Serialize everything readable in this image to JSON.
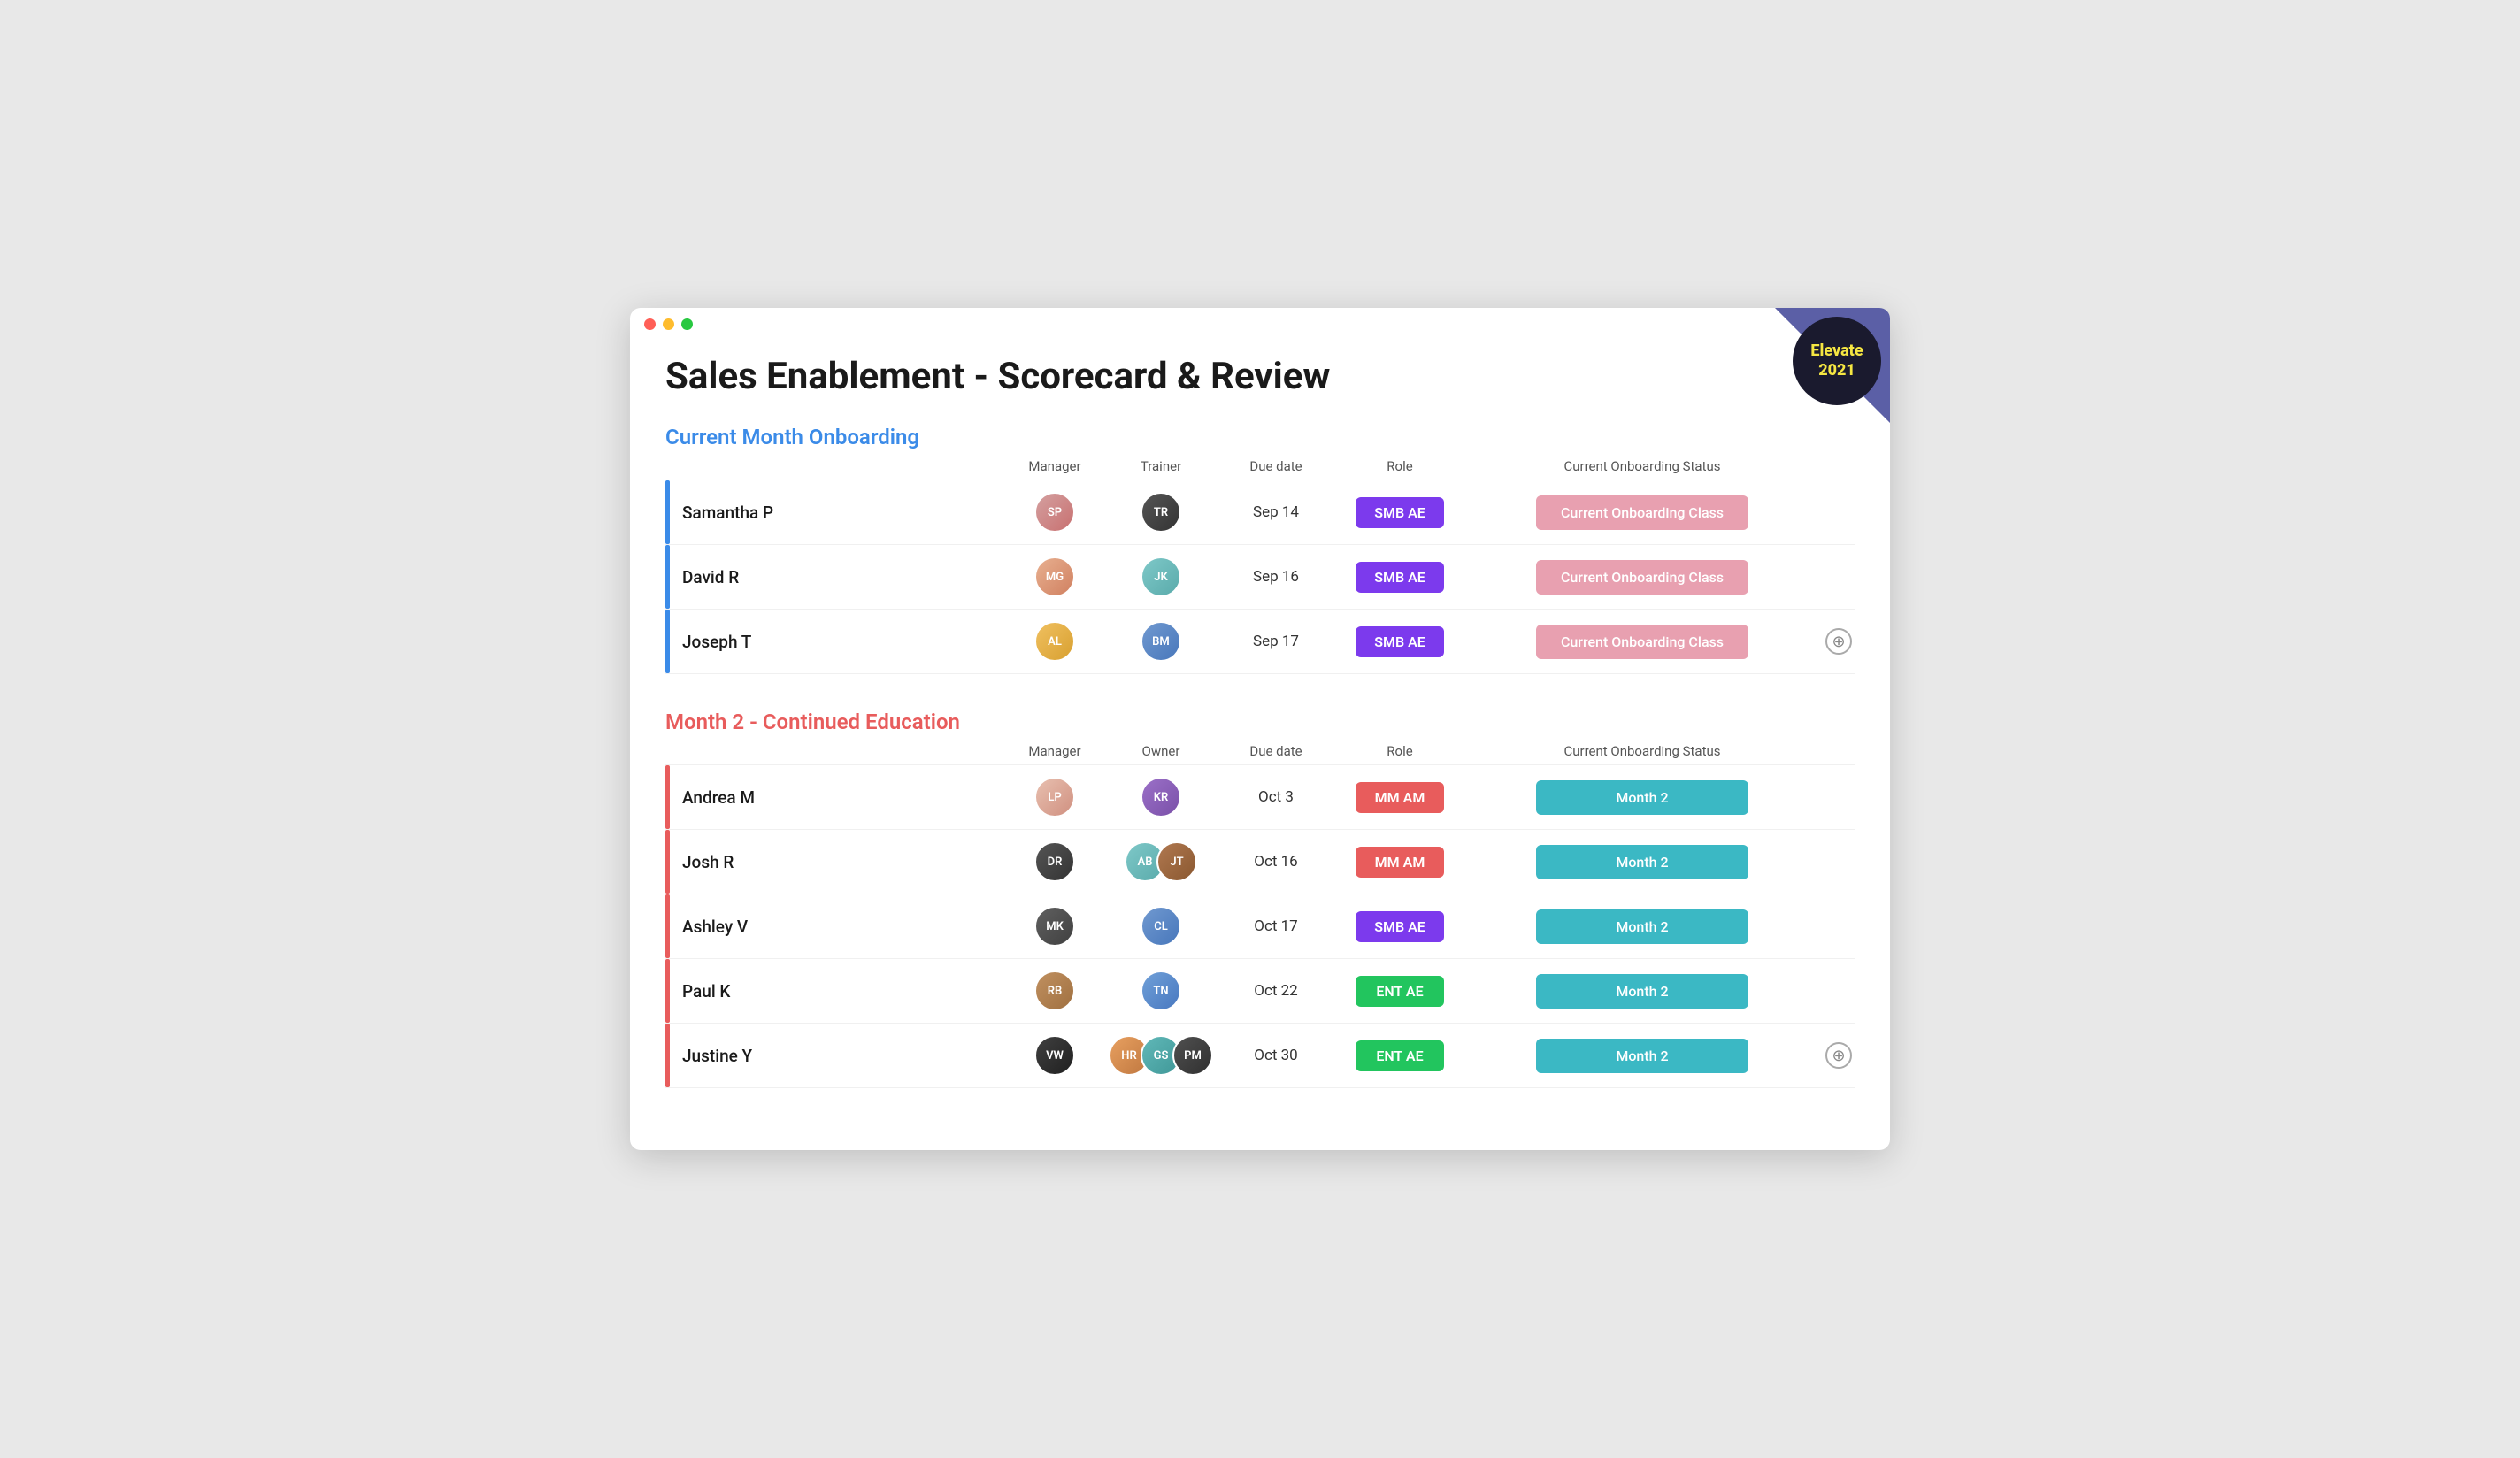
{
  "window": {
    "title": "Sales Enablement - Scorecard & Review"
  },
  "header": {
    "title": "Sales Enablement - Scorecard & Review"
  },
  "elevate": {
    "line1": "Elevate",
    "line2": "2021"
  },
  "section1": {
    "title": "Current Month Onboarding",
    "col_name": "",
    "col_manager": "Manager",
    "col_trainer": "Trainer",
    "col_due": "Due date",
    "col_role": "Role",
    "col_status": "Current Onboarding Status",
    "rows": [
      {
        "name": "Samantha P",
        "due": "Sep 14",
        "role": "SMB AE",
        "role_color": "purple",
        "status": "Current Onboarding Class",
        "status_color": "pink",
        "manager_initials": "SP",
        "manager_color": "pink",
        "trainer_initials": "TR",
        "trainer_color": "dark"
      },
      {
        "name": "David R",
        "due": "Sep 16",
        "role": "SMB AE",
        "role_color": "purple",
        "status": "Current Onboarding Class",
        "status_color": "pink",
        "manager_initials": "MG",
        "manager_color": "orange",
        "trainer_initials": "JK",
        "trainer_color": "teal"
      },
      {
        "name": "Joseph T",
        "due": "Sep 17",
        "role": "SMB AE",
        "role_color": "purple",
        "status": "Current Onboarding Class",
        "status_color": "pink",
        "manager_initials": "AL",
        "manager_color": "orange",
        "trainer_initials": "BM",
        "trainer_color": "blue"
      }
    ]
  },
  "section2": {
    "title": "Month 2 - Continued Education",
    "col_name": "",
    "col_manager": "Manager",
    "col_owner": "Owner",
    "col_due": "Due date",
    "col_role": "Role",
    "col_status": "Current Onboarding Status",
    "rows": [
      {
        "name": "Andrea M",
        "due": "Oct 3",
        "role": "MM AM",
        "role_color": "red",
        "status": "Month 2",
        "status_color": "teal",
        "manager_initials": "LP",
        "manager_color": "pink",
        "owner_initials": [
          "KR"
        ],
        "owner_colors": [
          "purple"
        ]
      },
      {
        "name": "Josh R",
        "due": "Oct 16",
        "role": "MM AM",
        "role_color": "red",
        "status": "Month 2",
        "status_color": "teal",
        "manager_initials": "DR",
        "manager_color": "dark",
        "owner_initials": [
          "AB",
          "JT"
        ],
        "owner_colors": [
          "teal",
          "brown"
        ]
      },
      {
        "name": "Ashley V",
        "due": "Oct 17",
        "role": "SMB AE",
        "role_color": "purple",
        "status": "Month 2",
        "status_color": "teal",
        "manager_initials": "MK",
        "manager_color": "dark",
        "owner_initials": [
          "CL"
        ],
        "owner_colors": [
          "blue"
        ]
      },
      {
        "name": "Paul K",
        "due": "Oct 22",
        "role": "ENT AE",
        "role_color": "green",
        "status": "Month 2",
        "status_color": "teal",
        "manager_initials": "RB",
        "manager_color": "brown",
        "owner_initials": [
          "TN"
        ],
        "owner_colors": [
          "blue"
        ]
      },
      {
        "name": "Justine Y",
        "due": "Oct 30",
        "role": "ENT AE",
        "role_color": "green",
        "status": "Month 2",
        "status_color": "teal",
        "manager_initials": "VW",
        "manager_color": "dark",
        "owner_initials": [
          "HR",
          "GS",
          "PM"
        ],
        "owner_colors": [
          "orange",
          "teal",
          "dark"
        ]
      }
    ]
  },
  "colors": {
    "purple": "#7c3aed",
    "red": "#e85c5c",
    "green": "#22c55e",
    "pink": "#e8a0b0",
    "teal": "#3bb8c4"
  }
}
